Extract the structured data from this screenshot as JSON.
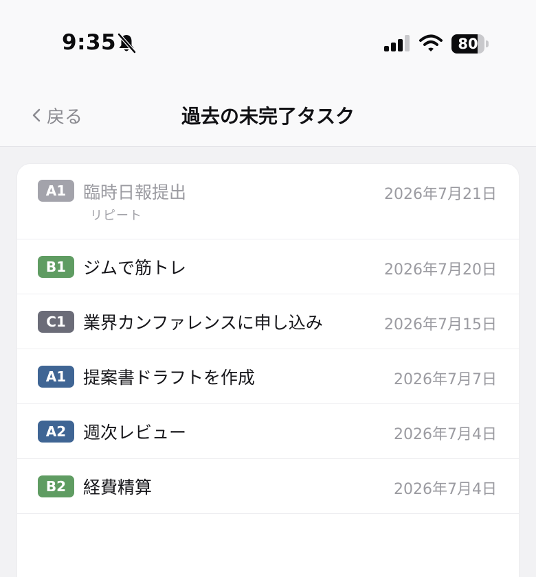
{
  "status": {
    "time": "9:35",
    "battery_level": "80",
    "battery_fraction": 0.8
  },
  "nav": {
    "back_label": "戻る",
    "title": "過去の未完了タスク"
  },
  "tasks": [
    {
      "badge": "A1",
      "badge_color": "#a3a3ab",
      "title": "臨時日報提出",
      "subtitle": "リピート",
      "date": "2026年7月21日",
      "dimmed": true
    },
    {
      "badge": "B1",
      "badge_color": "#5f9c62",
      "title": "ジムで筋トレ",
      "date": "2026年7月20日"
    },
    {
      "badge": "C1",
      "badge_color": "#6b6c78",
      "title": "業界カンファレンスに申し込み",
      "date": "2026年7月15日"
    },
    {
      "badge": "A1",
      "badge_color": "#3f6594",
      "title": "提案書ドラフトを作成",
      "date": "2026年7月7日"
    },
    {
      "badge": "A2",
      "badge_color": "#3f6594",
      "title": "週次レビュー",
      "date": "2026年7月4日"
    },
    {
      "badge": "B2",
      "badge_color": "#5f9c62",
      "title": "経費精算",
      "date": "2026年7月4日"
    }
  ]
}
